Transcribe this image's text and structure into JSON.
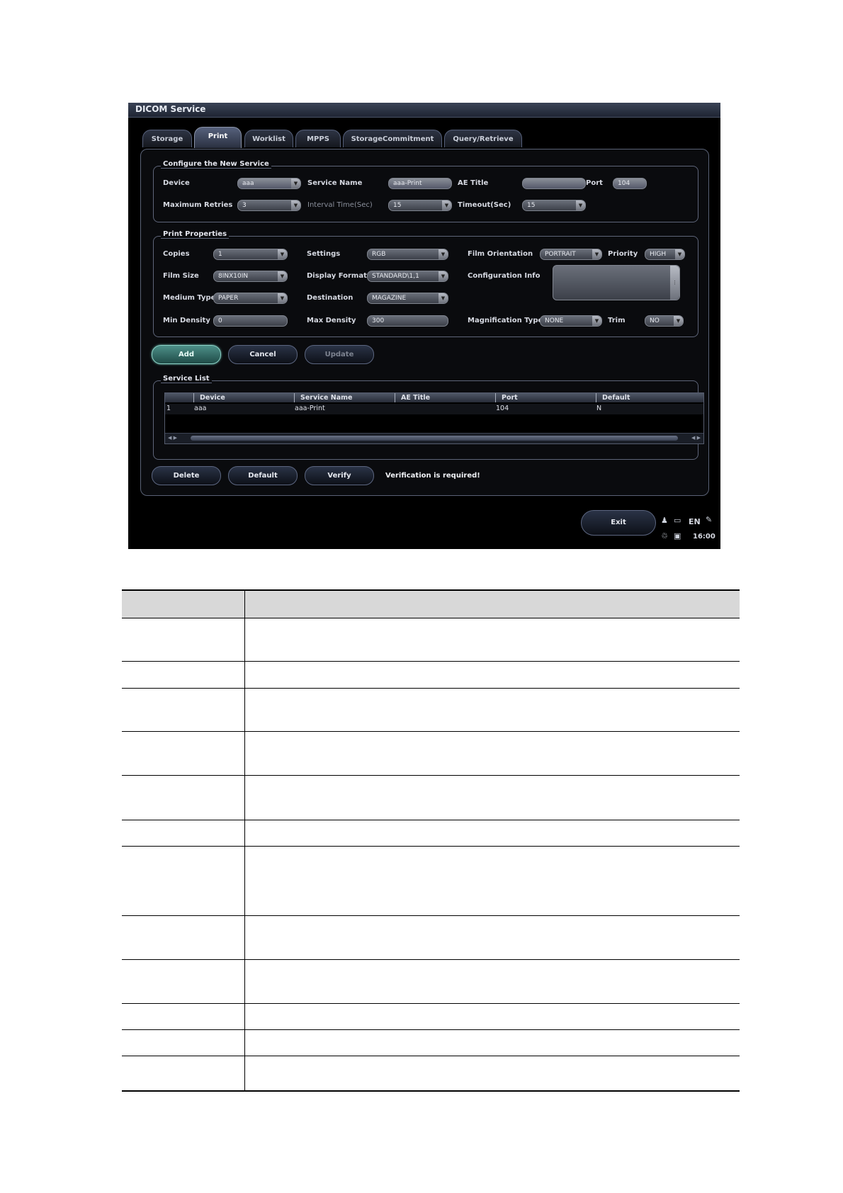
{
  "window": {
    "title": "DICOM Service"
  },
  "tabs": [
    {
      "label": "Storage",
      "active": false
    },
    {
      "label": "Print",
      "active": true
    },
    {
      "label": "Worklist",
      "active": false
    },
    {
      "label": "MPPS",
      "active": false
    },
    {
      "label": "StorageCommitment",
      "active": false
    },
    {
      "label": "Query/Retrieve",
      "active": false
    }
  ],
  "configure": {
    "legend": "Configure the New Service",
    "device_label": "Device",
    "device_value": "aaa",
    "service_name_label": "Service Name",
    "service_name_value": "aaa-Print",
    "ae_title_label": "AE Title",
    "ae_title_value": "",
    "port_label": "Port",
    "port_value": "104",
    "max_retries_label": "Maximum Retries",
    "max_retries_value": "3",
    "interval_label": "Interval Time(Sec)",
    "interval_value": "15",
    "timeout_label": "Timeout(Sec)",
    "timeout_value": "15"
  },
  "print_props": {
    "legend": "Print Properties",
    "copies_label": "Copies",
    "copies_value": "1",
    "settings_label": "Settings",
    "settings_value": "RGB",
    "film_orientation_label": "Film Orientation",
    "film_orientation_value": "PORTRAIT",
    "priority_label": "Priority",
    "priority_value": "HIGH",
    "film_size_label": "Film Size",
    "film_size_value": "8INX10IN",
    "display_format_label": "Display Format",
    "display_format_value": "STANDARD\\1,1",
    "config_info_label": "Configuration Info",
    "config_info_value": "",
    "medium_type_label": "Medium Type",
    "medium_type_value": "PAPER",
    "destination_label": "Destination",
    "destination_value": "MAGAZINE",
    "min_density_label": "Min Density",
    "min_density_value": "0",
    "max_density_label": "Max Density",
    "max_density_value": "300",
    "magnification_label": "Magnification Type",
    "magnification_value": "NONE",
    "trim_label": "Trim",
    "trim_value": "NO"
  },
  "action_buttons": {
    "add": "Add",
    "cancel": "Cancel",
    "update": "Update"
  },
  "service_list": {
    "legend": "Service List",
    "columns": [
      "Device",
      "Service Name",
      "AE Title",
      "Port",
      "Default"
    ],
    "rows": [
      {
        "index": "1",
        "device": "aaa",
        "service_name": "aaa-Print",
        "ae_title": "",
        "port": "104",
        "default": "N"
      }
    ]
  },
  "bottom_buttons": {
    "delete": "Delete",
    "default": "Default",
    "verify": "Verify"
  },
  "verify_message": "Verification is required!",
  "footer": {
    "exit": "Exit",
    "language": "EN",
    "time": "16:00"
  },
  "colors": {
    "accent_green": "#4d8f88",
    "window_bg": "#000000"
  }
}
